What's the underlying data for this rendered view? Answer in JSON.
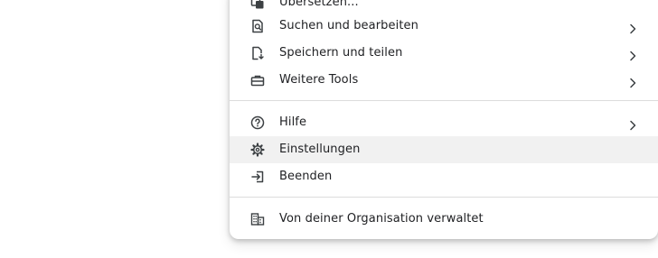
{
  "menu": {
    "items": [
      {
        "label": "Übersetzen...",
        "icon": "translate-icon"
      },
      {
        "label": "Suchen und bearbeiten",
        "icon": "find-in-page-icon",
        "submenu": true
      },
      {
        "label": "Speichern und teilen",
        "icon": "save-share-file-icon",
        "submenu": true
      },
      {
        "label": "Weitere Tools",
        "icon": "toolbox-icon",
        "submenu": true
      },
      {
        "label": "Hilfe",
        "icon": "help-circle-icon",
        "submenu": true
      },
      {
        "label": "Einstellungen",
        "icon": "gear-icon",
        "highlighted": true
      },
      {
        "label": "Beenden",
        "icon": "exit-icon"
      },
      {
        "label": "Von deiner Organisation verwaltet",
        "icon": "organization-building-icon"
      }
    ]
  },
  "colors": {
    "text": "#202124",
    "highlight": "#f1f1f1",
    "divider": "#dcdcdc"
  }
}
